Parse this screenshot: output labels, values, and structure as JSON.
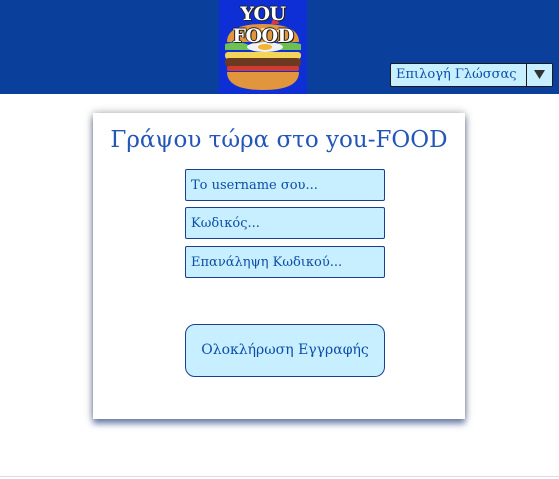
{
  "header": {
    "logo_text": "YOU FOOD",
    "logo_icon": "burger-icon",
    "background_color": "#0a3f9b"
  },
  "language": {
    "selected": "Επιλογή Γλώσσας",
    "arrow_icon": "chevron-down-icon"
  },
  "form": {
    "title": "Γράψου τώρα στο you-FOOD",
    "username_placeholder": "Το username σου...",
    "password_placeholder": "Κωδικός...",
    "repeat_password_placeholder": "Επανάληψη Κωδικού...",
    "submit_label": "Ολοκλήρωση Εγγραφής"
  },
  "colors": {
    "accent": "#2356b8",
    "field_background": "#c7efff",
    "field_text": "#0d4da8"
  }
}
